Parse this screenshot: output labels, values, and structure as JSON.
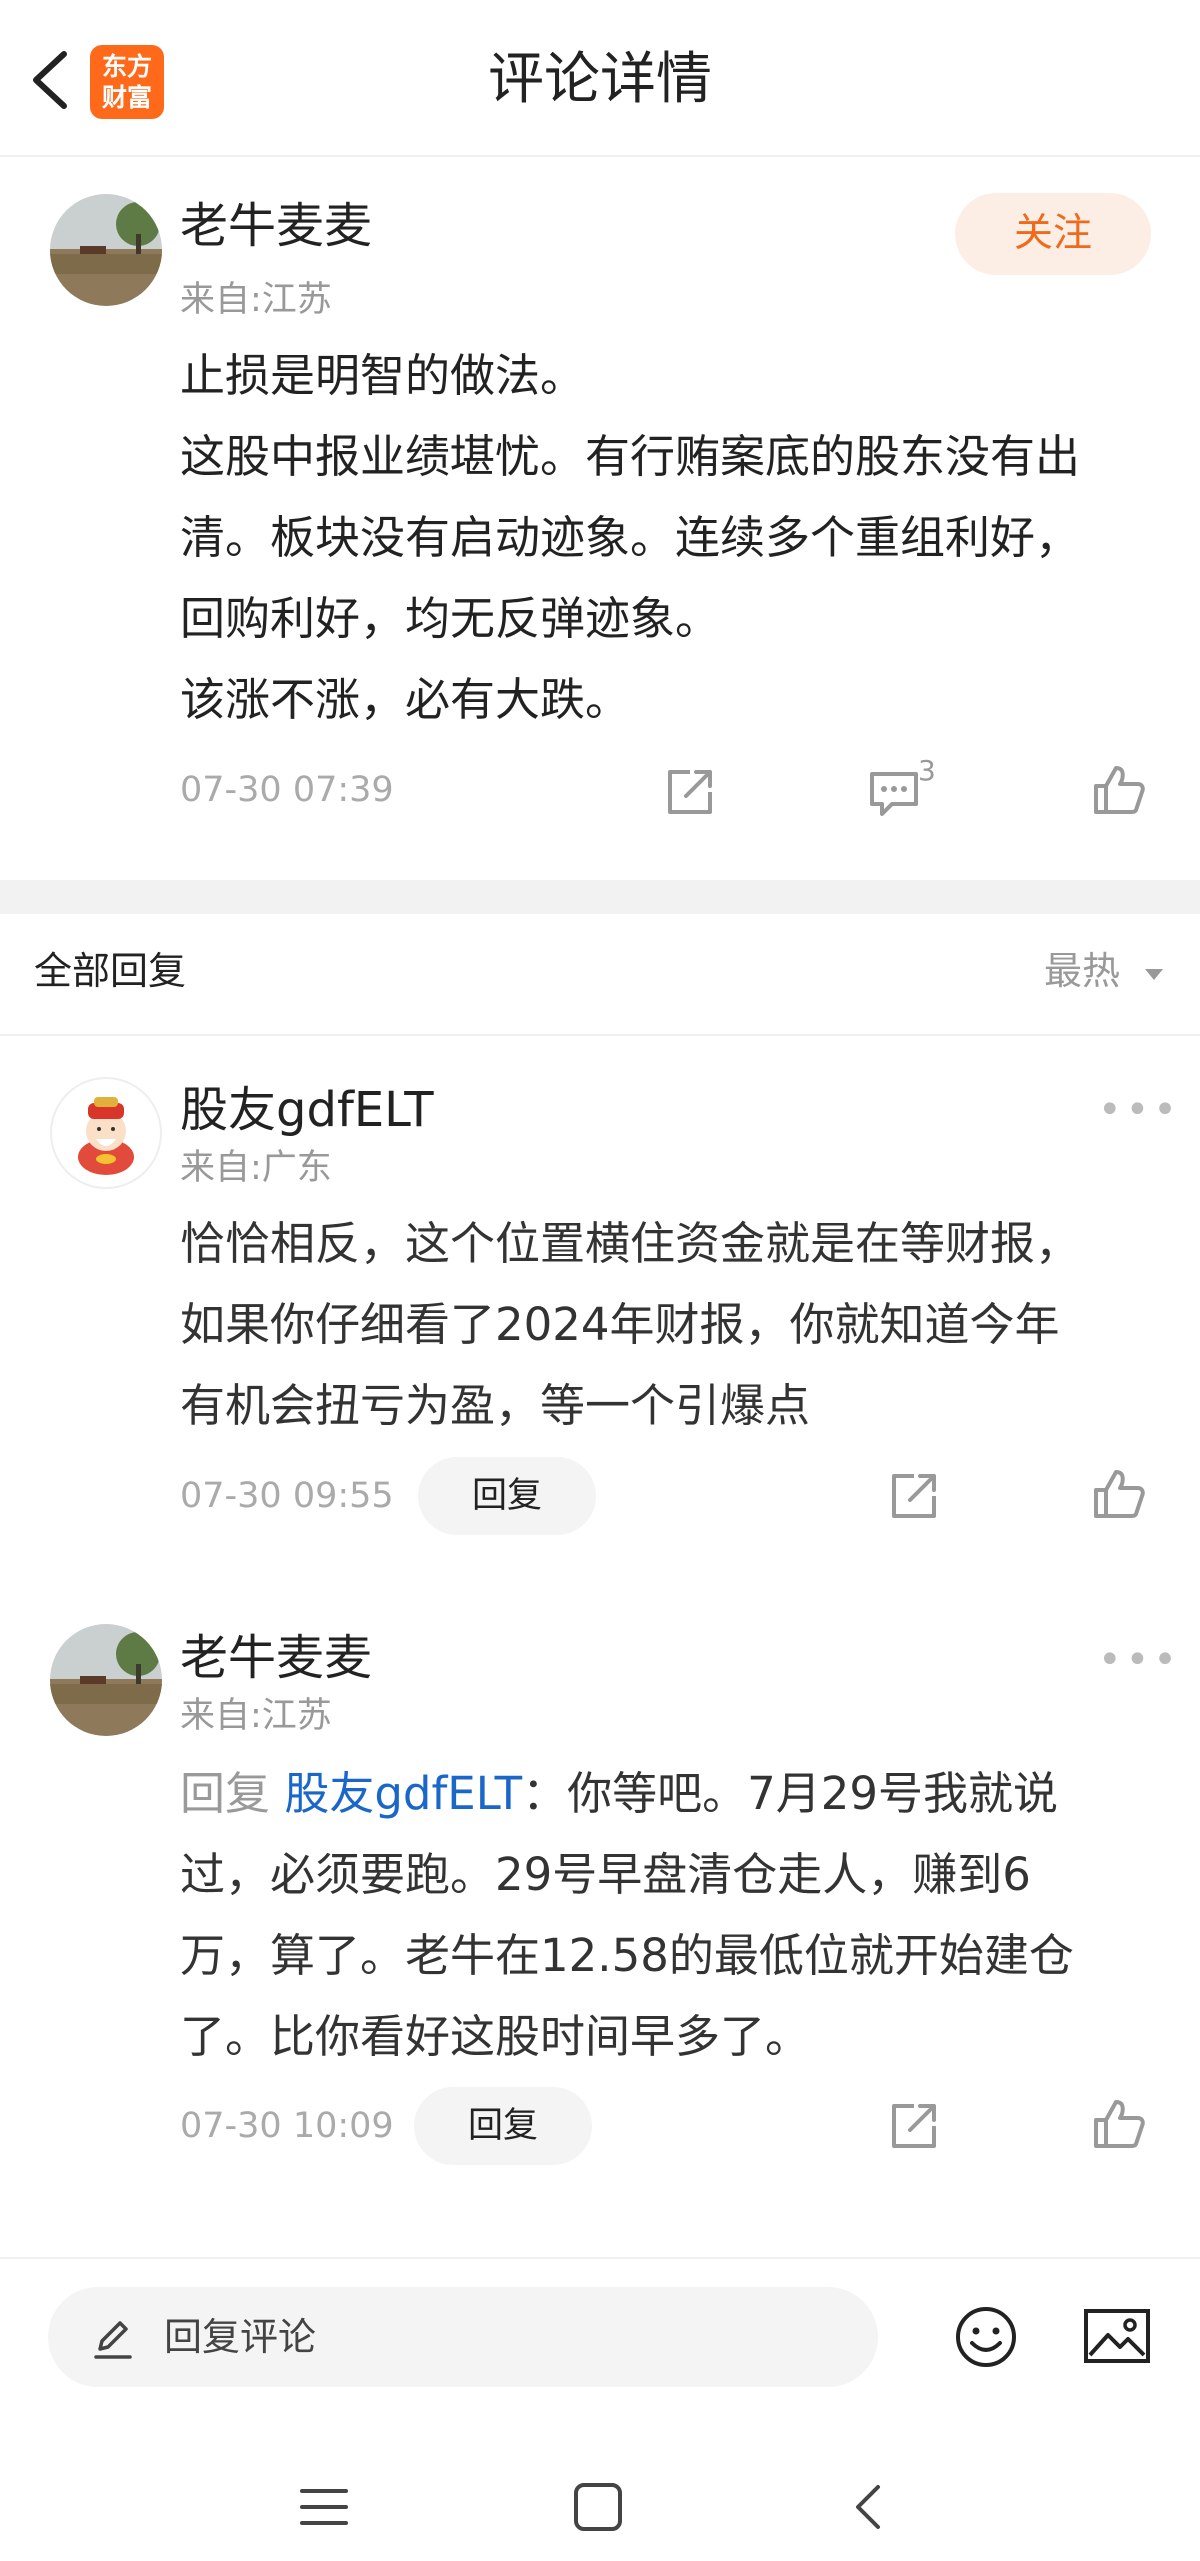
{
  "header": {
    "title": "评论详情",
    "logo_line1": "东方",
    "logo_line2": "财富"
  },
  "post": {
    "author": "老牛麦麦",
    "location": "来自:江苏",
    "follow_label": "关注",
    "lines": [
      "止损是明智的做法。",
      "这股中报业绩堪忧。有行贿案底的股东没有出",
      "清。板块没有启动迹象。连续多个重组利好，",
      "回购利好，均无反弹迹象。",
      "该涨不涨，必有大跌。"
    ],
    "time": "07-30 07:39",
    "comment_count": "3"
  },
  "replies_header": {
    "title": "全部回复",
    "sort_label": "最热"
  },
  "replies": [
    {
      "author": "股友gdfELT",
      "location": "来自:广东",
      "lines": [
        "恰恰相反，这个位置横住资金就是在等财报，",
        "如果你仔细看了2024年财报，你就知道今年",
        "有机会扭亏为盈，等一个引爆点"
      ],
      "time": "07-30 09:55",
      "reply_label": "回复"
    },
    {
      "author": "老牛麦麦",
      "location": "来自:江苏",
      "reply_prefix": "回复",
      "reply_to": "股友gdfELT",
      "first_line_rest": "：你等吧。7月29号我就说",
      "lines": [
        "过，必须要跑。29号早盘清仓走人，赚到6",
        "万，算了。老牛在12.58的最低位就开始建仓",
        "了。比你看好这股时间早多了。"
      ],
      "time": "07-30 10:09",
      "reply_label": "回复"
    }
  ],
  "bottom": {
    "input_placeholder": "回复评论"
  },
  "colors": {
    "accent": "#ef6a1b",
    "link": "#1a66c9",
    "brand": "#ff6a1a"
  }
}
